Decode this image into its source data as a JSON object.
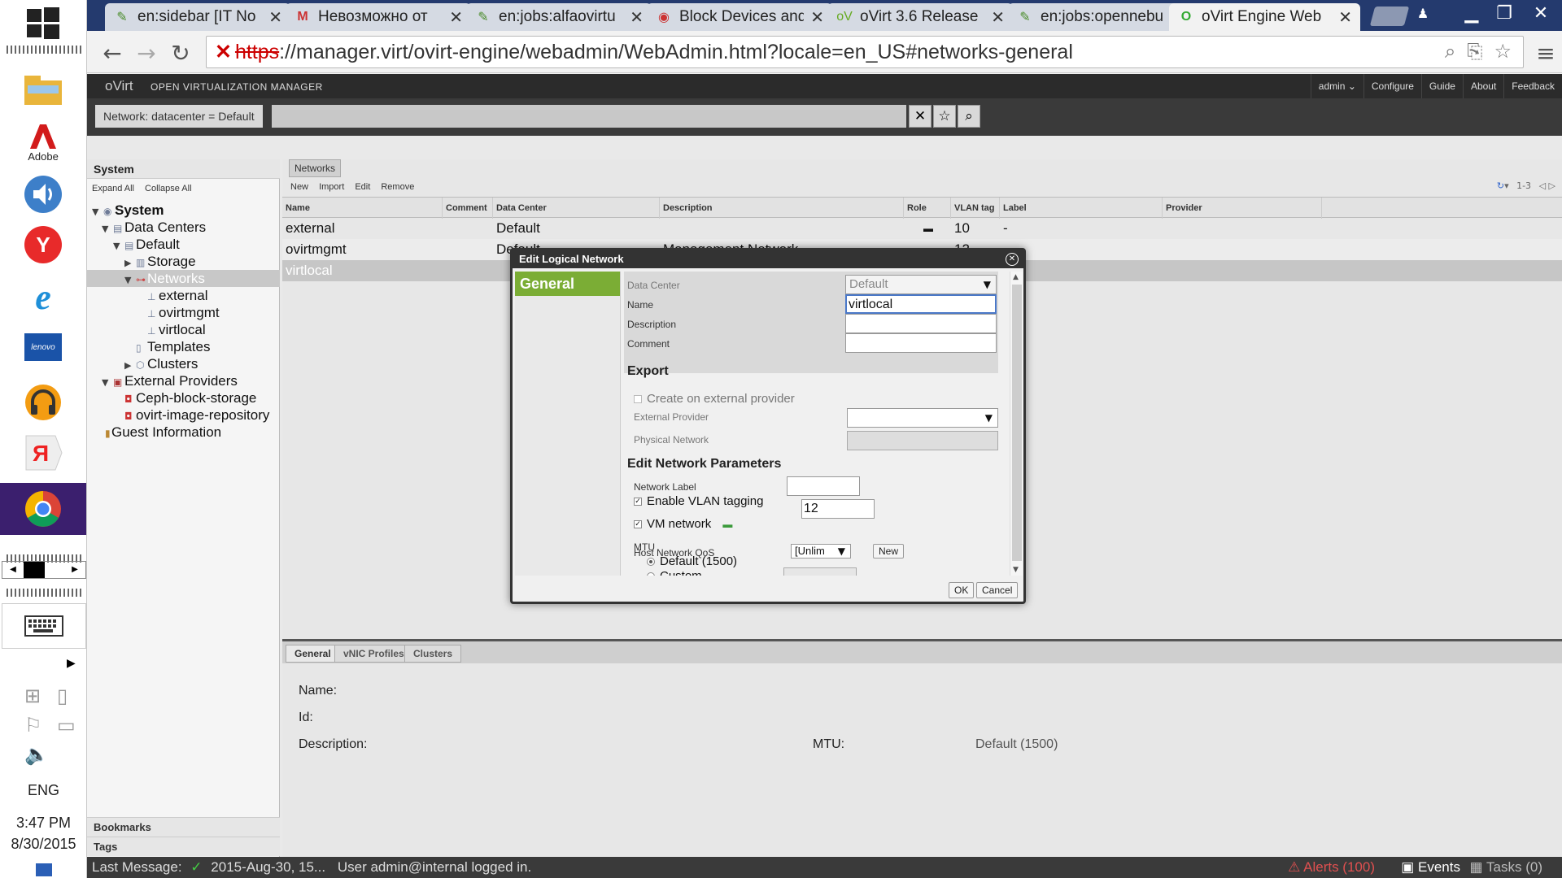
{
  "taskbar": {
    "apps": [
      "file-explorer",
      "adobe",
      "volume-app",
      "yandex-browser",
      "internet-explorer",
      "lenovo",
      "google-music",
      "yandex",
      "chrome"
    ],
    "adobe_label": "Adobe",
    "lenovo_label": "lenovo",
    "language": "ENG",
    "time": "3:47 PM",
    "date": "8/30/2015"
  },
  "browser": {
    "tabs": [
      {
        "title": "en:sidebar [IT No",
        "icon": "wiki-icon"
      },
      {
        "title": "Невозможно от",
        "icon": "gmail-icon"
      },
      {
        "title": "en:jobs:alfaovirtu",
        "icon": "wiki-icon"
      },
      {
        "title": "Block Devices and",
        "icon": "block-devices-icon"
      },
      {
        "title": "oVirt 3.6 Release",
        "icon": "ovirt-icon"
      },
      {
        "title": "en:jobs:opennebu",
        "icon": "wiki-icon"
      },
      {
        "title": "oVirt Engine Web",
        "icon": "ovirt-engine-icon",
        "active": true
      }
    ],
    "url_proto": "https",
    "url_rest": "://manager.virt/ovirt-engine/webadmin/WebAdmin.html?locale=en_US#networks-general"
  },
  "app": {
    "logo": "oVirt",
    "product": "OPEN VIRTUALIZATION MANAGER",
    "header_links": [
      "admin ⌄",
      "Configure",
      "Guide",
      "About",
      "Feedback"
    ],
    "search_prefix": "Network: datacenter = Default",
    "left": {
      "title": "System",
      "expand_all": "Expand All",
      "collapse_all": "Collapse All",
      "tree": [
        {
          "label": "System",
          "level": 0,
          "arrow": "▼",
          "bold": true
        },
        {
          "label": "Data Centers",
          "level": 1,
          "arrow": "▼"
        },
        {
          "label": "Default",
          "level": 2,
          "arrow": "▼"
        },
        {
          "label": "Storage",
          "level": 3,
          "arrow": "▶"
        },
        {
          "label": "Networks",
          "level": 3,
          "arrow": "▼",
          "selected": true
        },
        {
          "label": "external",
          "level": 4,
          "arrow": ""
        },
        {
          "label": "ovirtmgmt",
          "level": 4,
          "arrow": ""
        },
        {
          "label": "virtlocal",
          "level": 4,
          "arrow": ""
        },
        {
          "label": "Templates",
          "level": 3,
          "arrow": ""
        },
        {
          "label": "Clusters",
          "level": 3,
          "arrow": "▶"
        },
        {
          "label": "External Providers",
          "level": 1,
          "arrow": "▼"
        },
        {
          "label": "Ceph-block-storage",
          "level": 2,
          "arrow": ""
        },
        {
          "label": "ovirt-image-repository",
          "level": 2,
          "arrow": ""
        },
        {
          "label": "Guest Information",
          "level": 1,
          "arrow": ""
        }
      ],
      "bookmarks": "Bookmarks",
      "tags": "Tags"
    },
    "main": {
      "subtab": "Networks",
      "toolbar": [
        "New",
        "Import",
        "Edit",
        "Remove"
      ],
      "pager": "1-3",
      "columns": [
        "Name",
        "Comment",
        "Data Center",
        "Description",
        "Role",
        "VLAN tag",
        "Label",
        "Provider"
      ],
      "rows": [
        {
          "name": "external",
          "comment": "",
          "dc": "Default",
          "desc": "",
          "vlan": "10",
          "label": "-"
        },
        {
          "name": "ovirtmgmt",
          "comment": "",
          "dc": "Default",
          "desc": "Management Network",
          "vlan": "12",
          "label": ""
        },
        {
          "name": "virtlocal",
          "comment": "",
          "dc": "",
          "desc": "",
          "vlan": "",
          "label": "",
          "selected": true
        }
      ],
      "detail_tabs": [
        "General",
        "vNIC Profiles",
        "Clusters"
      ],
      "detail": {
        "name_label": "Name:",
        "id_label": "Id:",
        "desc_label": "Description:",
        "mtu_label": "MTU:",
        "mtu_value": "Default (1500)"
      }
    },
    "status": {
      "last_message_label": "Last Message:",
      "timestamp": "2015-Aug-30, 15...",
      "message": "User admin@internal logged in.",
      "alerts": "Alerts (100)",
      "events": "Events",
      "tasks": "Tasks (0)"
    }
  },
  "dialog": {
    "title": "Edit Logical Network",
    "nav_general": "General",
    "data_center_label": "Data Center",
    "data_center_value": "Default",
    "name_label": "Name",
    "name_value": "virtlocal",
    "description_label": "Description",
    "comment_label": "Comment",
    "export_heading": "Export",
    "create_external_label": "Create on external provider",
    "external_provider_label": "External Provider",
    "physical_network_label": "Physical Network",
    "params_heading": "Edit Network Parameters",
    "network_label_label": "Network Label",
    "vlan_label": "Enable VLAN tagging",
    "vlan_value": "12",
    "vm_network_label": "VM network",
    "mtu_label": "MTU",
    "mtu_default": "Default (1500)",
    "mtu_custom": "Custom",
    "qos_label": "Host Network QoS",
    "qos_value": "[Unlim",
    "new_button": "New",
    "ok_button": "OK",
    "cancel_button": "Cancel"
  }
}
